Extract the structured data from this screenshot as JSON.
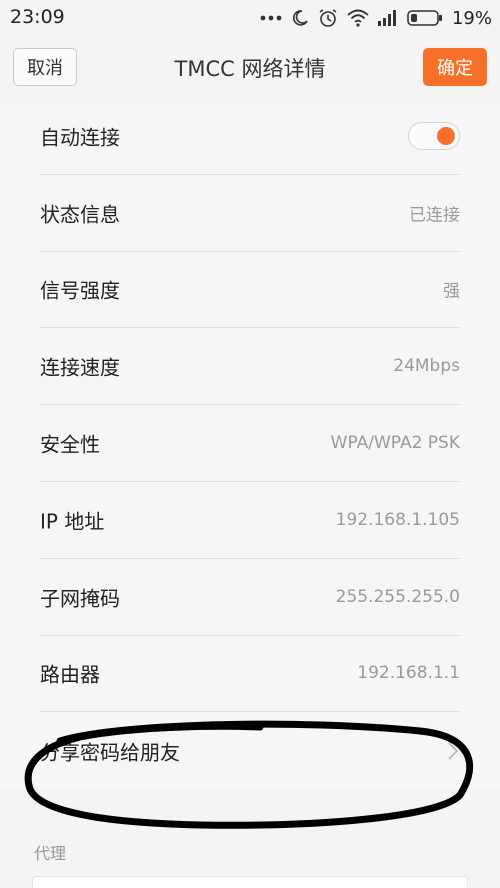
{
  "status_bar": {
    "time": "23:09",
    "battery_percent": "19%",
    "icons": [
      "more-dots-icon",
      "moon-icon",
      "alarm-icon",
      "wifi-icon",
      "signal-icon",
      "battery-icon"
    ]
  },
  "header": {
    "title": "TMCC 网络详情",
    "cancel_label": "取消",
    "confirm_label": "确定"
  },
  "colors": {
    "accent": "#f7702a",
    "text_primary": "#222222",
    "text_secondary": "#9a9a9a"
  },
  "rows": [
    {
      "label": "自动连接",
      "toggle_on": true
    },
    {
      "label": "状态信息",
      "value": "已连接"
    },
    {
      "label": "信号强度",
      "value": "强"
    },
    {
      "label": "连接速度",
      "value": "24Mbps"
    },
    {
      "label": "安全性",
      "value": "WPA/WPA2 PSK"
    },
    {
      "label": "IP 地址",
      "value": "192.168.1.105"
    },
    {
      "label": "子网掩码",
      "value": "255.255.255.0"
    },
    {
      "label": "路由器",
      "value": "192.168.1.1"
    },
    {
      "label": "分享密码给朋友",
      "icon": "chevron-right-icon"
    }
  ],
  "proxy_section": {
    "header": "代理"
  }
}
